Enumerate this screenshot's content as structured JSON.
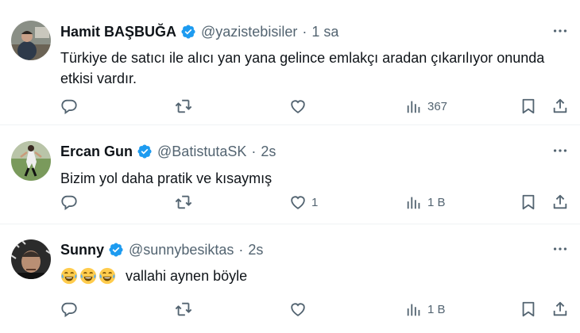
{
  "tweets": [
    {
      "name": "Hamit BAŞBUĞA",
      "handle": "@yazistebisiler",
      "separator": "·",
      "time": "1 sa",
      "text": "Türkiye de satıcı ile alıcı yan yana gelince emlakçı aradan çıkarılıyor onunda etkisi vardır.",
      "likes": "",
      "views": "367"
    },
    {
      "name": "Ercan Gun",
      "handle": "@BatistutaSK",
      "separator": "·",
      "time": "2s",
      "text": "Bizim yol daha pratik ve kısaymış",
      "likes": "1",
      "views": "1 B"
    },
    {
      "name": "Sunny",
      "handle": "@sunnybesiktas",
      "separator": "·",
      "time": "2s",
      "emojis": [
        "face-with-tears-of-joy",
        "face-with-tears-of-joy",
        "face-with-tears-of-joy"
      ],
      "text": "vallahi aynen böyle",
      "likes": "",
      "views": "1 B"
    }
  ],
  "colors": {
    "text": "#0f1419",
    "secondary": "#536471",
    "verified": "#1d9bf0",
    "divider": "#eff3f4"
  },
  "icons": [
    "verified-badge-icon",
    "more-icon",
    "reply-icon",
    "retweet-icon",
    "like-icon",
    "views-icon",
    "bookmark-icon",
    "share-icon"
  ]
}
